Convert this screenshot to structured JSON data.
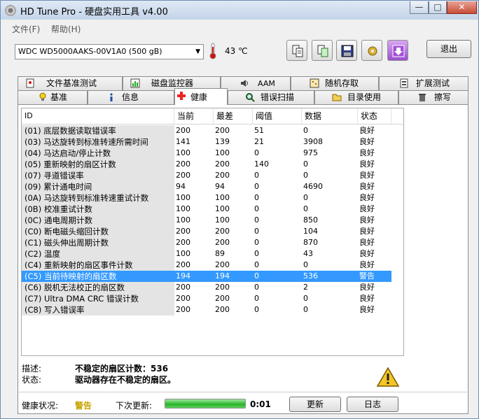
{
  "window": {
    "title": "HD Tune Pro - 硬盘实用工具 v4.00",
    "minimize": "—",
    "maximize": "□",
    "close": "✕"
  },
  "menu": {
    "file": "文件(F)",
    "help": "帮助(H)"
  },
  "toolbar": {
    "drive": "WDC WD5000AAKS-00V1A0 (500 gB)",
    "temperature": "43 ℃",
    "exit": "退出"
  },
  "tabs_top": [
    "文件基准测试",
    "磁盘监控器",
    "AAM",
    "随机存取",
    "扩展测试"
  ],
  "tabs_bottom": [
    "基准",
    "信息",
    "健康",
    "错误扫描",
    "目录使用",
    "擦写"
  ],
  "table": {
    "headers": [
      "ID",
      "当前",
      "最差",
      "阈值",
      "数据",
      "状态"
    ],
    "rows": [
      {
        "id": "(01) 底层数据读取错误率",
        "cur": "200",
        "worst": "200",
        "thr": "51",
        "data": "0",
        "status": "良好"
      },
      {
        "id": "(03) 马达旋转到标准转速所需时间",
        "cur": "141",
        "worst": "139",
        "thr": "21",
        "data": "3908",
        "status": "良好"
      },
      {
        "id": "(04) 马达启动/停止计数",
        "cur": "100",
        "worst": "100",
        "thr": "0",
        "data": "975",
        "status": "良好"
      },
      {
        "id": "(05) 重新映射的扇区计数",
        "cur": "200",
        "worst": "200",
        "thr": "140",
        "data": "0",
        "status": "良好"
      },
      {
        "id": "(07) 寻道错误率",
        "cur": "200",
        "worst": "200",
        "thr": "0",
        "data": "0",
        "status": "良好"
      },
      {
        "id": "(09) 累计通电时间",
        "cur": "94",
        "worst": "94",
        "thr": "0",
        "data": "4690",
        "status": "良好"
      },
      {
        "id": "(0A) 马达旋转到标准转速重试计数",
        "cur": "100",
        "worst": "100",
        "thr": "0",
        "data": "0",
        "status": "良好"
      },
      {
        "id": "(0B) 校准重试计数",
        "cur": "100",
        "worst": "100",
        "thr": "0",
        "data": "0",
        "status": "良好"
      },
      {
        "id": "(0C) 通电周期计数",
        "cur": "100",
        "worst": "100",
        "thr": "0",
        "data": "850",
        "status": "良好"
      },
      {
        "id": "(C0) 断电磁头缩回计数",
        "cur": "200",
        "worst": "200",
        "thr": "0",
        "data": "104",
        "status": "良好"
      },
      {
        "id": "(C1) 磁头伸出周期计数",
        "cur": "200",
        "worst": "200",
        "thr": "0",
        "data": "870",
        "status": "良好"
      },
      {
        "id": "(C2) 温度",
        "cur": "100",
        "worst": "89",
        "thr": "0",
        "data": "43",
        "status": "良好"
      },
      {
        "id": "(C4) 重新映射的扇区事件计数",
        "cur": "200",
        "worst": "200",
        "thr": "0",
        "data": "0",
        "status": "良好"
      },
      {
        "id": "(C5) 当前待映射的扇区数",
        "cur": "194",
        "worst": "194",
        "thr": "0",
        "data": "536",
        "status": "警告",
        "selected": true
      },
      {
        "id": "(C6) 脱机无法校正的扇区数",
        "cur": "200",
        "worst": "200",
        "thr": "0",
        "data": "2",
        "status": "良好"
      },
      {
        "id": "(C7) Ultra DMA CRC 错误计数",
        "cur": "200",
        "worst": "200",
        "thr": "0",
        "data": "0",
        "status": "良好"
      },
      {
        "id": "(C8) 写入错误率",
        "cur": "200",
        "worst": "200",
        "thr": "0",
        "data": "0",
        "status": "良好"
      }
    ]
  },
  "details": {
    "desc_label": "描述:",
    "desc_value": "不稳定的扇区计数：536",
    "state_label": "状态:",
    "state_value": "驱动器存在不稳定的扇区。"
  },
  "statusbar": {
    "health_label": "健康状况:",
    "health_value": "警告",
    "next_label": "下次更新:",
    "progress": 1.0,
    "timer": "0:01",
    "refresh": "更新",
    "log": "日志"
  }
}
